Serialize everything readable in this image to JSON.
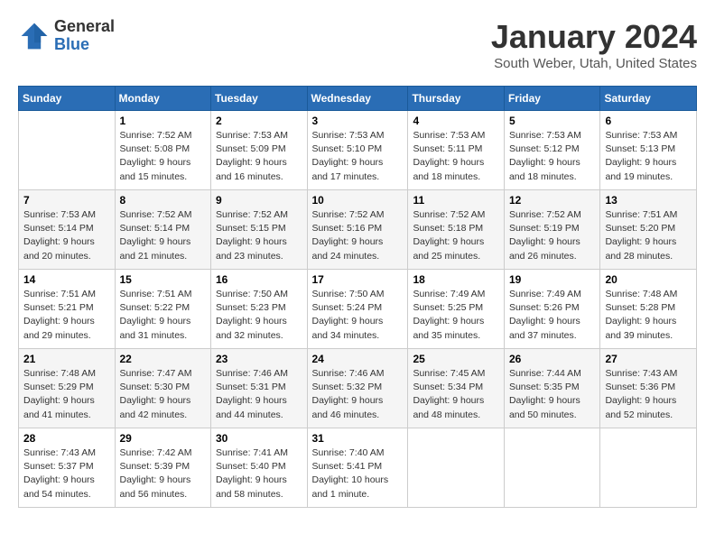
{
  "logo": {
    "general": "General",
    "blue": "Blue"
  },
  "title": "January 2024",
  "subtitle": "South Weber, Utah, United States",
  "days_of_week": [
    "Sunday",
    "Monday",
    "Tuesday",
    "Wednesday",
    "Thursday",
    "Friday",
    "Saturday"
  ],
  "weeks": [
    [
      {
        "day": "",
        "info": ""
      },
      {
        "day": "1",
        "info": "Sunrise: 7:52 AM\nSunset: 5:08 PM\nDaylight: 9 hours\nand 15 minutes."
      },
      {
        "day": "2",
        "info": "Sunrise: 7:53 AM\nSunset: 5:09 PM\nDaylight: 9 hours\nand 16 minutes."
      },
      {
        "day": "3",
        "info": "Sunrise: 7:53 AM\nSunset: 5:10 PM\nDaylight: 9 hours\nand 17 minutes."
      },
      {
        "day": "4",
        "info": "Sunrise: 7:53 AM\nSunset: 5:11 PM\nDaylight: 9 hours\nand 18 minutes."
      },
      {
        "day": "5",
        "info": "Sunrise: 7:53 AM\nSunset: 5:12 PM\nDaylight: 9 hours\nand 18 minutes."
      },
      {
        "day": "6",
        "info": "Sunrise: 7:53 AM\nSunset: 5:13 PM\nDaylight: 9 hours\nand 19 minutes."
      }
    ],
    [
      {
        "day": "7",
        "info": "Sunrise: 7:53 AM\nSunset: 5:14 PM\nDaylight: 9 hours\nand 20 minutes."
      },
      {
        "day": "8",
        "info": "Sunrise: 7:52 AM\nSunset: 5:14 PM\nDaylight: 9 hours\nand 21 minutes."
      },
      {
        "day": "9",
        "info": "Sunrise: 7:52 AM\nSunset: 5:15 PM\nDaylight: 9 hours\nand 23 minutes."
      },
      {
        "day": "10",
        "info": "Sunrise: 7:52 AM\nSunset: 5:16 PM\nDaylight: 9 hours\nand 24 minutes."
      },
      {
        "day": "11",
        "info": "Sunrise: 7:52 AM\nSunset: 5:18 PM\nDaylight: 9 hours\nand 25 minutes."
      },
      {
        "day": "12",
        "info": "Sunrise: 7:52 AM\nSunset: 5:19 PM\nDaylight: 9 hours\nand 26 minutes."
      },
      {
        "day": "13",
        "info": "Sunrise: 7:51 AM\nSunset: 5:20 PM\nDaylight: 9 hours\nand 28 minutes."
      }
    ],
    [
      {
        "day": "14",
        "info": "Sunrise: 7:51 AM\nSunset: 5:21 PM\nDaylight: 9 hours\nand 29 minutes."
      },
      {
        "day": "15",
        "info": "Sunrise: 7:51 AM\nSunset: 5:22 PM\nDaylight: 9 hours\nand 31 minutes."
      },
      {
        "day": "16",
        "info": "Sunrise: 7:50 AM\nSunset: 5:23 PM\nDaylight: 9 hours\nand 32 minutes."
      },
      {
        "day": "17",
        "info": "Sunrise: 7:50 AM\nSunset: 5:24 PM\nDaylight: 9 hours\nand 34 minutes."
      },
      {
        "day": "18",
        "info": "Sunrise: 7:49 AM\nSunset: 5:25 PM\nDaylight: 9 hours\nand 35 minutes."
      },
      {
        "day": "19",
        "info": "Sunrise: 7:49 AM\nSunset: 5:26 PM\nDaylight: 9 hours\nand 37 minutes."
      },
      {
        "day": "20",
        "info": "Sunrise: 7:48 AM\nSunset: 5:28 PM\nDaylight: 9 hours\nand 39 minutes."
      }
    ],
    [
      {
        "day": "21",
        "info": "Sunrise: 7:48 AM\nSunset: 5:29 PM\nDaylight: 9 hours\nand 41 minutes."
      },
      {
        "day": "22",
        "info": "Sunrise: 7:47 AM\nSunset: 5:30 PM\nDaylight: 9 hours\nand 42 minutes."
      },
      {
        "day": "23",
        "info": "Sunrise: 7:46 AM\nSunset: 5:31 PM\nDaylight: 9 hours\nand 44 minutes."
      },
      {
        "day": "24",
        "info": "Sunrise: 7:46 AM\nSunset: 5:32 PM\nDaylight: 9 hours\nand 46 minutes."
      },
      {
        "day": "25",
        "info": "Sunrise: 7:45 AM\nSunset: 5:34 PM\nDaylight: 9 hours\nand 48 minutes."
      },
      {
        "day": "26",
        "info": "Sunrise: 7:44 AM\nSunset: 5:35 PM\nDaylight: 9 hours\nand 50 minutes."
      },
      {
        "day": "27",
        "info": "Sunrise: 7:43 AM\nSunset: 5:36 PM\nDaylight: 9 hours\nand 52 minutes."
      }
    ],
    [
      {
        "day": "28",
        "info": "Sunrise: 7:43 AM\nSunset: 5:37 PM\nDaylight: 9 hours\nand 54 minutes."
      },
      {
        "day": "29",
        "info": "Sunrise: 7:42 AM\nSunset: 5:39 PM\nDaylight: 9 hours\nand 56 minutes."
      },
      {
        "day": "30",
        "info": "Sunrise: 7:41 AM\nSunset: 5:40 PM\nDaylight: 9 hours\nand 58 minutes."
      },
      {
        "day": "31",
        "info": "Sunrise: 7:40 AM\nSunset: 5:41 PM\nDaylight: 10 hours\nand 1 minute."
      },
      {
        "day": "",
        "info": ""
      },
      {
        "day": "",
        "info": ""
      },
      {
        "day": "",
        "info": ""
      }
    ]
  ]
}
